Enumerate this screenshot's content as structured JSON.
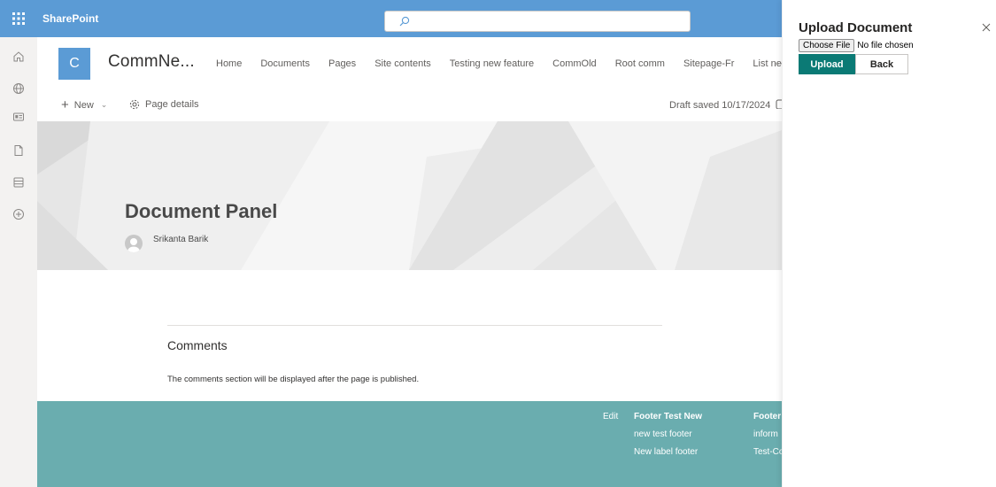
{
  "suitebar": {
    "app_name": "SharePoint",
    "search_placeholder": ""
  },
  "leftrail": {
    "icons": [
      "home-icon",
      "globe-icon",
      "news-icon",
      "document-icon",
      "list-icon",
      "add-circle-icon"
    ]
  },
  "site": {
    "logo_letter": "C",
    "title": "CommNe...",
    "nav_items": [
      "Home",
      "Documents",
      "Pages",
      "Site contents",
      "Testing new feature",
      "CommOld",
      "Root comm",
      "Sitepage-Fr",
      "List new"
    ],
    "nav_more": "···"
  },
  "commandbar": {
    "new_label": "New",
    "page_details_label": "Page details",
    "draft_status": "Draft saved 10/17/2024"
  },
  "hero": {
    "title": "Document Panel",
    "author": "Srikanta Barik"
  },
  "comments": {
    "title": "Comments",
    "note": "The comments section will be displayed after the page is published."
  },
  "footer": {
    "edit_label": "Edit",
    "col1": [
      "Footer Test New",
      "new test footer",
      "New label footer"
    ],
    "col2": [
      "Footer",
      "inform",
      "Test-Co"
    ]
  },
  "panel": {
    "title": "Upload Document",
    "choose_file_label": "Choose File",
    "file_status": "No file chosen",
    "upload_label": "Upload",
    "back_label": "Back"
  },
  "colors": {
    "suitebar": "#5b9bd5",
    "footer": "#6aadaf",
    "upload_button": "#0b7a75"
  }
}
